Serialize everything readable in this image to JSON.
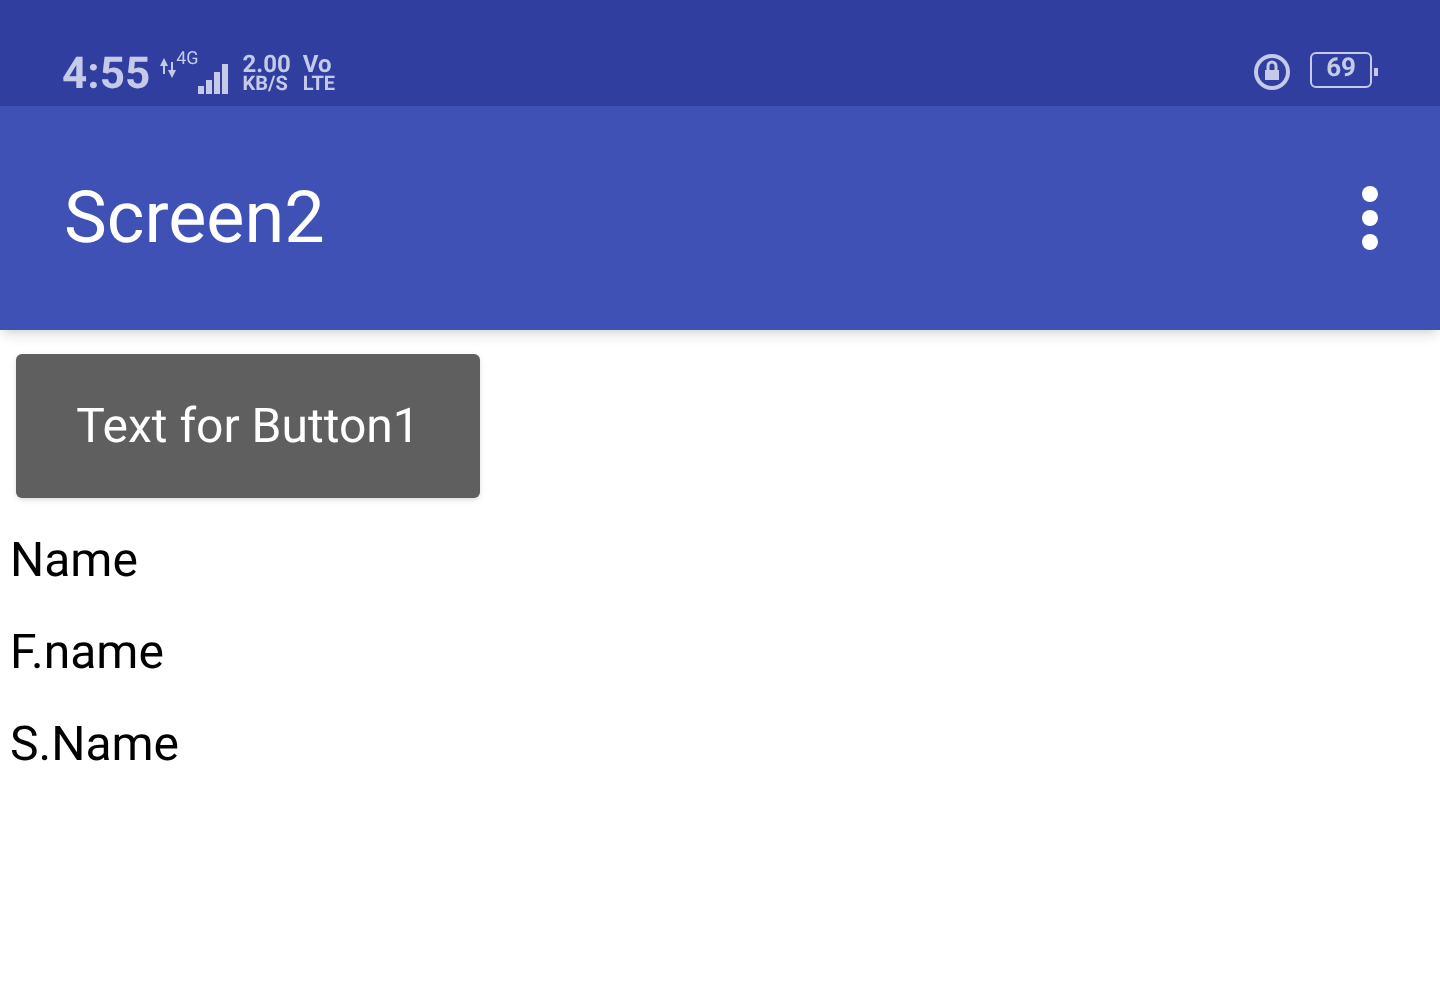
{
  "status_bar": {
    "time": "4:55",
    "network": "4G",
    "speed_value": "2.00",
    "speed_unit": "KB/S",
    "volte_top": "Vo",
    "volte_bottom": "LTE",
    "battery": "69"
  },
  "app_bar": {
    "title": "Screen2"
  },
  "button": {
    "label": "Text for Button1"
  },
  "labels": [
    "Name",
    "F.name",
    "S.Name"
  ]
}
